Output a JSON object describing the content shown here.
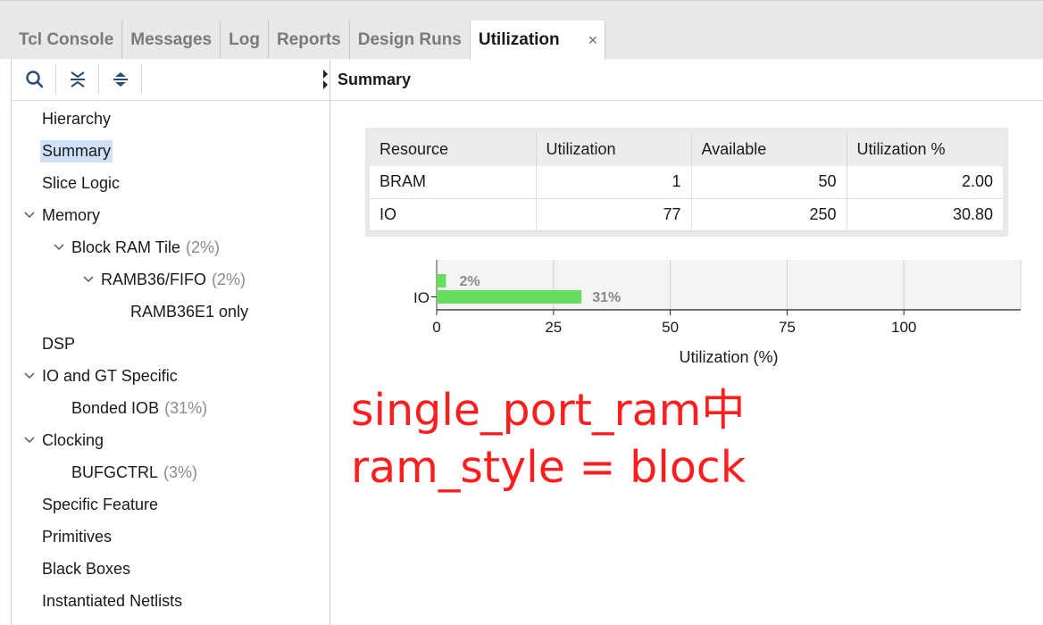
{
  "tabs": [
    {
      "label": "Tcl Console",
      "active": false
    },
    {
      "label": "Messages",
      "active": false
    },
    {
      "label": "Log",
      "active": false
    },
    {
      "label": "Reports",
      "active": false
    },
    {
      "label": "Design Runs",
      "active": false
    },
    {
      "label": "Utilization",
      "active": true
    }
  ],
  "tab_close_glyph": "×",
  "toolbar": {
    "icons": [
      "search-icon",
      "collapse-all-icon",
      "expand-all-icon"
    ]
  },
  "tree": [
    {
      "label": "Hierarchy",
      "pct": "",
      "expander": false
    },
    {
      "label": "Summary",
      "pct": "",
      "expander": false,
      "selected": true
    },
    {
      "label": "Slice Logic",
      "pct": "",
      "expander": false
    },
    {
      "label": "Memory",
      "pct": "",
      "expander": true
    },
    {
      "label": "Block RAM Tile",
      "pct": "(2%)",
      "expander": true
    },
    {
      "label": "RAMB36/FIFO",
      "pct": "(2%)",
      "expander": true
    },
    {
      "label": "RAMB36E1 only",
      "pct": "",
      "expander": false
    },
    {
      "label": "DSP",
      "pct": "",
      "expander": false
    },
    {
      "label": "IO and GT Specific",
      "pct": "",
      "expander": true
    },
    {
      "label": "Bonded IOB",
      "pct": "(31%)",
      "expander": false
    },
    {
      "label": "Clocking",
      "pct": "",
      "expander": true
    },
    {
      "label": "BUFGCTRL",
      "pct": "(3%)",
      "expander": false
    },
    {
      "label": "Specific Feature",
      "pct": "",
      "expander": false
    },
    {
      "label": "Primitives",
      "pct": "",
      "expander": false
    },
    {
      "label": "Black Boxes",
      "pct": "",
      "expander": false
    },
    {
      "label": "Instantiated Netlists",
      "pct": "",
      "expander": false
    }
  ],
  "panel_title": "Summary",
  "table": {
    "headers": [
      "Resource",
      "Utilization",
      "Available",
      "Utilization %"
    ],
    "rows": [
      [
        "BRAM",
        "1",
        "50",
        "2.00"
      ],
      [
        "IO",
        "77",
        "250",
        "30.80"
      ]
    ]
  },
  "chart_data": {
    "type": "bar",
    "orientation": "horizontal",
    "categories": [
      "BRAM",
      "IO"
    ],
    "category_labels_shown": [
      "",
      "IO"
    ],
    "values": [
      2,
      31
    ],
    "value_labels": [
      "2%",
      "31%"
    ],
    "xlabel": "Utilization (%)",
    "xticks": [
      0,
      25,
      50,
      75,
      100
    ],
    "xlim": [
      0,
      125
    ],
    "grid": true,
    "bar_color": "#66dd5e"
  },
  "annotation": {
    "lines": [
      "single_port_ram中",
      "ram_style = block"
    ],
    "color": "#ff1e1e"
  }
}
